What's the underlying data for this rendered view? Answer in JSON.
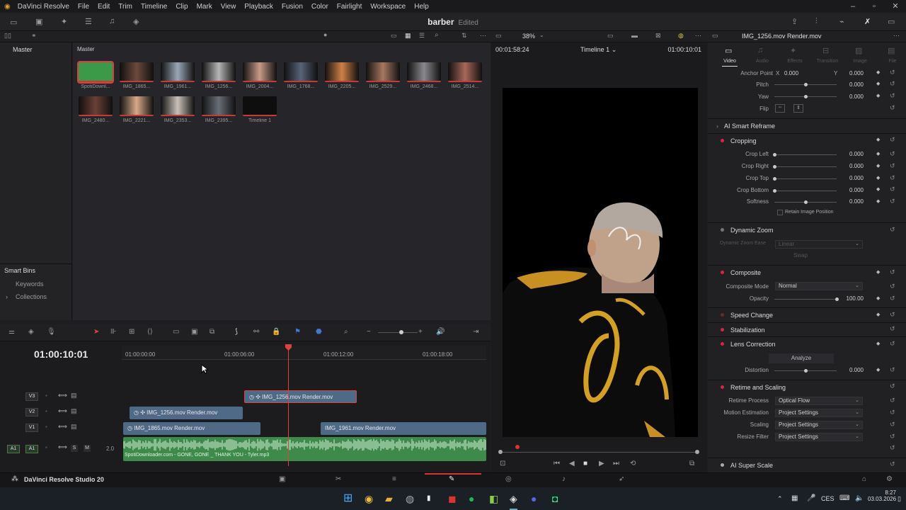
{
  "app": {
    "name": "DaVinci Resolve",
    "menu": [
      "File",
      "Edit",
      "Trim",
      "Timeline",
      "Clip",
      "Mark",
      "View",
      "Playback",
      "Fusion",
      "Color",
      "Fairlight",
      "Workspace",
      "Help"
    ],
    "project_title": "barber",
    "project_status": "Edited",
    "product_label": "DaVinci Resolve Studio 20"
  },
  "media_pool": {
    "left_header": "Master",
    "header": "Master",
    "clips": [
      {
        "label": "SpotiDownl...",
        "color": "#3a9a48",
        "selected": true
      },
      {
        "label": "IMG_1865...",
        "color": "#6b4a3c"
      },
      {
        "label": "IMG_1961...",
        "color": "#9aa6b6"
      },
      {
        "label": "IMG_1256...",
        "color": "#b6b6b6"
      },
      {
        "label": "IMG_2004...",
        "color": "#c89a88"
      },
      {
        "label": "IMG_1768...",
        "color": "#586478"
      },
      {
        "label": "IMG_2205...",
        "color": "#d08048"
      },
      {
        "label": "IMG_2529...",
        "color": "#a87860"
      },
      {
        "label": "IMG_2468...",
        "color": "#8a8a8e"
      },
      {
        "label": "IMG_2514...",
        "color": "#a8685a"
      },
      {
        "label": "IMG_2480...",
        "color": "#6a4036"
      },
      {
        "label": "IMG_2221...",
        "color": "#d8a888"
      },
      {
        "label": "IMG_2353...",
        "color": "#c8c0b8"
      },
      {
        "label": "IMG_2395...",
        "color": "#686e76"
      },
      {
        "label": "Timeline 1",
        "color": "#0e0e0e"
      }
    ],
    "smart_bins": {
      "title": "Smart Bins",
      "items": [
        "Keywords",
        "Collections"
      ]
    }
  },
  "viewer": {
    "zoom": "38%",
    "source_tc": "00:01:58:24",
    "timeline_name": "Timeline 1",
    "record_tc": "01:00:10:01"
  },
  "inspector": {
    "clip_name": "IMG_1256.mov Render.mov",
    "tabs": [
      "Video",
      "Audio",
      "Effects",
      "Transition",
      "Image",
      "File"
    ],
    "active_tab": "Video",
    "anchor_point": {
      "label": "Anchor Point",
      "x_label": "X",
      "x": "0.000",
      "y_label": "Y",
      "y": "0.000"
    },
    "pitch": {
      "label": "Pitch",
      "value": "0.000"
    },
    "yaw": {
      "label": "Yaw",
      "value": "0.000"
    },
    "flip": {
      "label": "Flip"
    },
    "ai_smart_reframe": "AI Smart Reframe",
    "cropping": {
      "title": "Cropping",
      "crop_left": {
        "label": "Crop Left",
        "value": "0.000"
      },
      "crop_right": {
        "label": "Crop Right",
        "value": "0.000"
      },
      "crop_top": {
        "label": "Crop Top",
        "value": "0.000"
      },
      "crop_bottom": {
        "label": "Crop Bottom",
        "value": "0.000"
      },
      "softness": {
        "label": "Softness",
        "value": "0.000"
      },
      "retain": "Retain Image Position"
    },
    "dynamic_zoom": {
      "title": "Dynamic Zoom",
      "ease_label": "Dynamic Zoom Ease",
      "ease_value": "Linear",
      "swap": "Swap"
    },
    "composite": {
      "title": "Composite",
      "mode_label": "Composite Mode",
      "mode_value": "Normal",
      "opacity_label": "Opacity",
      "opacity_value": "100.00"
    },
    "speed_change": "Speed Change",
    "stabilization": "Stabilization",
    "lens_correction": {
      "title": "Lens Correction",
      "analyze": "Analyze",
      "distortion_label": "Distortion",
      "distortion_value": "0.000"
    },
    "retime_scaling": {
      "title": "Retime and Scaling",
      "retime_process": {
        "label": "Retime Process",
        "value": "Optical Flow"
      },
      "motion_estimation": {
        "label": "Motion Estimation",
        "value": "Project Settings"
      },
      "scaling": {
        "label": "Scaling",
        "value": "Project Settings"
      },
      "resize_filter": {
        "label": "Resize Filter",
        "value": "Project Settings"
      }
    },
    "ai_super_scale": "AI Super Scale"
  },
  "timeline": {
    "timecode": "01:00:10:01",
    "ruler": [
      "01:00:00:00",
      "01:00:06:00",
      "01:00:12:00",
      "01:00:18:00"
    ],
    "tracks": {
      "v3": {
        "label": "V3",
        "clips": [
          {
            "name": "IMG_1256.mov Render.mov"
          }
        ]
      },
      "v2": {
        "label": "V2",
        "clips": [
          {
            "name": "IMG_1256.mov Render.mov"
          }
        ]
      },
      "v1": {
        "label": "V1",
        "clips": [
          {
            "name": "IMG_1865.mov Render.mov"
          },
          {
            "name": "IMG_1961.mov Render.mov"
          }
        ]
      },
      "a1": {
        "label": "A1",
        "patch": "A1",
        "level": "2.0",
        "clips": [
          {
            "name": "SpotiDownloader.com - GONE, GONE _ THANK YOU - Tyler.mp3"
          }
        ]
      }
    }
  },
  "taskbar": {
    "lang": "CES",
    "time": "8:27",
    "date": "03.03.2026"
  }
}
